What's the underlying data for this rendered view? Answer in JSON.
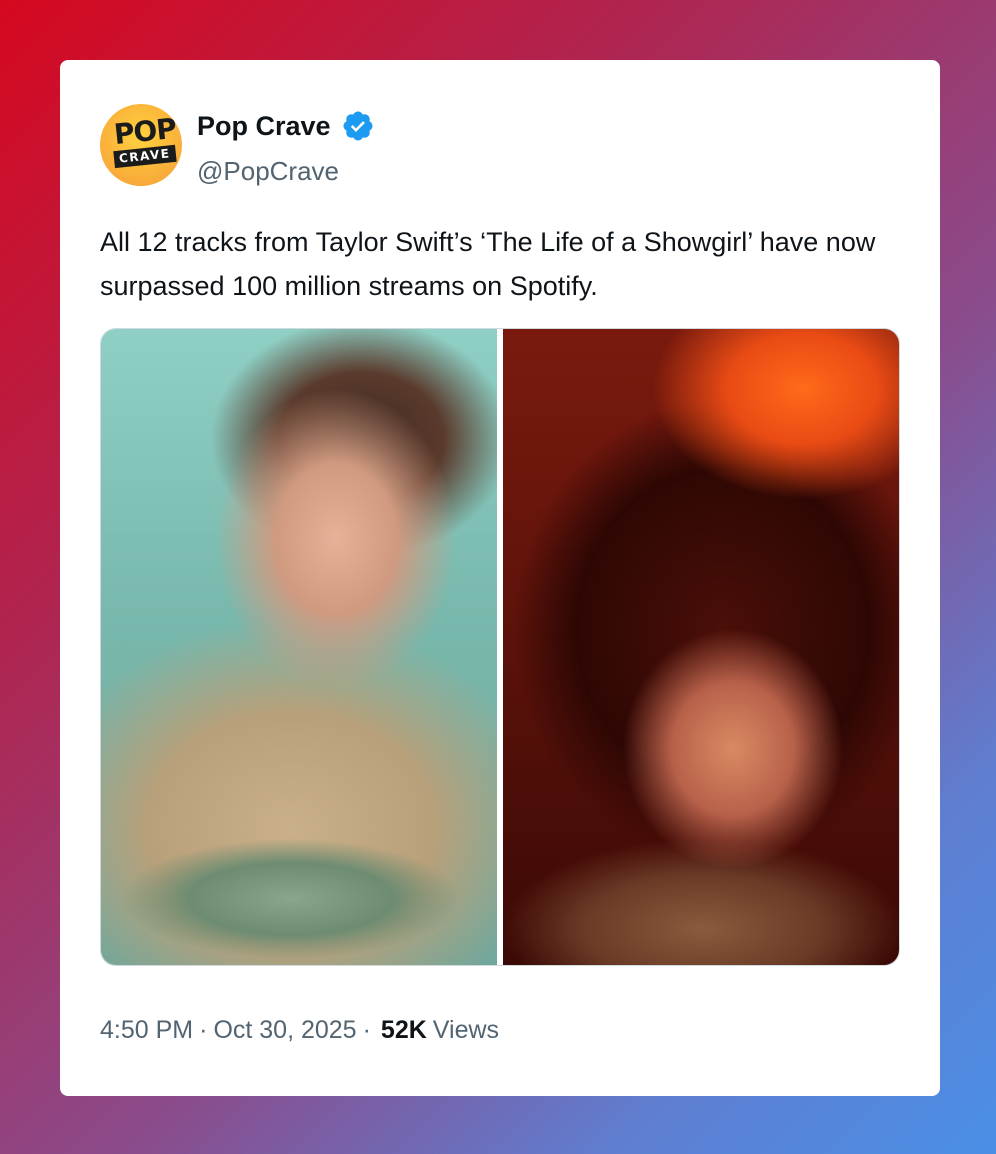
{
  "author": {
    "display_name": "Pop Crave",
    "handle": "@PopCrave",
    "avatar_text_top": "POP",
    "avatar_text_bottom": "CRAVE",
    "verified": true
  },
  "tweet": {
    "text": "All 12 tracks from Taylor Swift’s ‘The Life of a Showgirl’ have now surpassed 100 million streams on Spotify.",
    "time": "4:50 PM",
    "date": "Oct 30, 2025",
    "views_count": "52K",
    "views_label": "Views"
  },
  "icons": {
    "verified_badge": "verified-check-icon"
  },
  "colors": {
    "verified_blue": "#1d9bf0",
    "text_primary": "#0f1419",
    "text_secondary": "#536471"
  }
}
